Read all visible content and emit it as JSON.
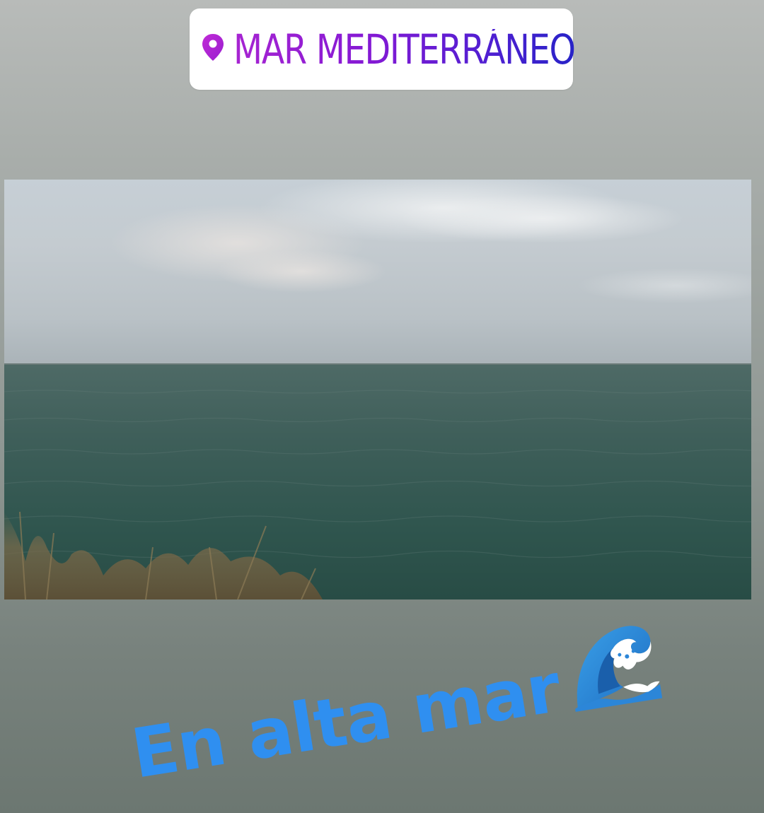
{
  "story": {
    "location_sticker": {
      "label": "MAR MEDITERRÁNEO",
      "icon": "location-pin-icon",
      "gradient_colors": [
        "#a724d2",
        "#2723c7"
      ]
    },
    "photo": {
      "subject": "sea-horizon-photo"
    },
    "caption": {
      "text": "En alta mar",
      "emoji": "water-wave-icon",
      "color": "#2f8ff0"
    }
  }
}
